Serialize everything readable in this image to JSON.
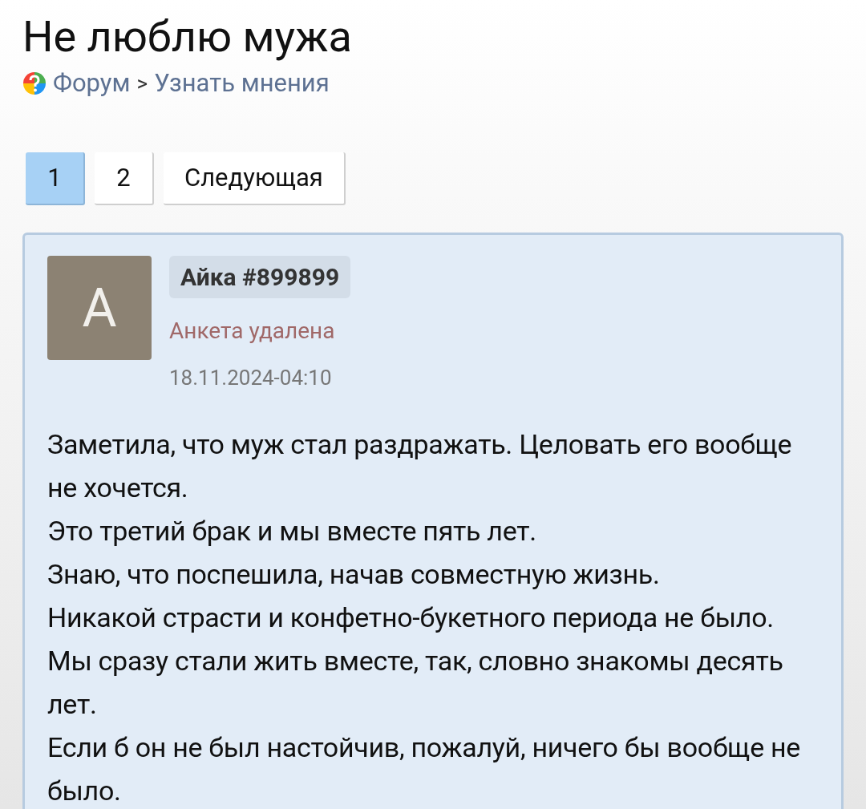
{
  "title": "Не люблю мужа",
  "breadcrumb": [
    {
      "label": "Форум"
    },
    {
      "label": "Узнать мнения"
    }
  ],
  "breadcrumb_separator": ">",
  "pagination": [
    {
      "label": "1",
      "selected": true
    },
    {
      "label": "2",
      "selected": false
    },
    {
      "label": "Следующая",
      "selected": false
    }
  ],
  "post": {
    "avatar_letter": "А",
    "author": "Айка #899899",
    "profile_status": "Анкета удалена",
    "date": "18.11.2024-04:10",
    "paragraphs": [
      "Заметила, что муж стал раздражать. Целовать его вообще не хочется.",
      "Это третий брак и мы вместе пять лет.",
      "Знаю, что поспешила, начав совместную жизнь.",
      "Никакой страсти и конфетно-букетного периода не было. Мы сразу стали жить вместе, так, словно знакомы десять лет.",
      "Если б он не был настойчив, пожалуй, ничего бы вообще не было."
    ]
  }
}
